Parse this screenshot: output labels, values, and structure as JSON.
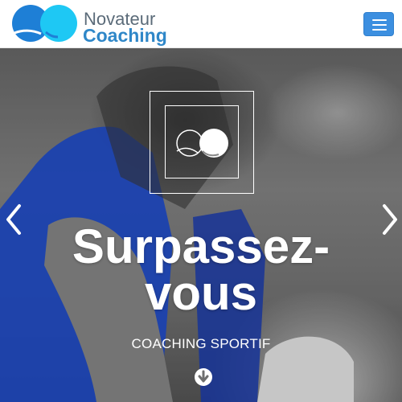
{
  "header": {
    "brand_top": "Novateur",
    "brand_bottom": "Coaching",
    "logo_icon": "logo-circles-icon",
    "menu_icon": "hamburger-menu-icon"
  },
  "hero": {
    "headline_line1": "Surpassez-",
    "headline_line2": "vous",
    "subtitle": "COACHING SPORTIF",
    "emblem_icon": "logo-emblem-icon",
    "prev_icon": "chevron-left-icon",
    "next_icon": "chevron-right-icon",
    "scroll_icon": "arrow-down-circle-icon"
  },
  "colors": {
    "brand_blue": "#2f87c8",
    "brand_gray": "#5b6b79",
    "logo_dark_blue": "#1e7fd6",
    "logo_cyan": "#1ec8f4",
    "menu_button": "#3c8fe0",
    "hero_accent_blue": "#1f4fd8"
  }
}
